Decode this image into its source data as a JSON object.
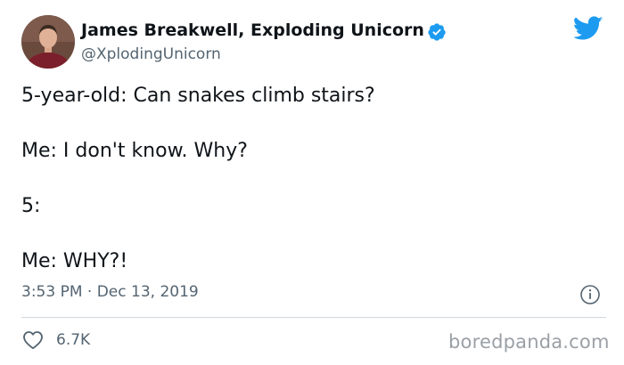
{
  "author": {
    "display_name": "James Breakwell, Exploding Unicorn",
    "handle": "@XplodingUnicorn",
    "verified": true,
    "avatar_icon": "person-avatar"
  },
  "brand_icon": "twitter-bird-icon",
  "colors": {
    "twitter_blue": "#1d9bf0",
    "text_primary": "#0f1419",
    "text_secondary": "#536471",
    "divider": "#cfd9de",
    "watermark": "#9aa0a6"
  },
  "tweet": {
    "lines": [
      "5-year-old: Can snakes climb stairs?",
      "Me: I don't know. Why?",
      "5:",
      "Me: WHY?!"
    ],
    "timestamp": "3:53 PM · Dec 13, 2019"
  },
  "engagement": {
    "likes": "6.7K"
  },
  "watermark": "boredpanda.com"
}
